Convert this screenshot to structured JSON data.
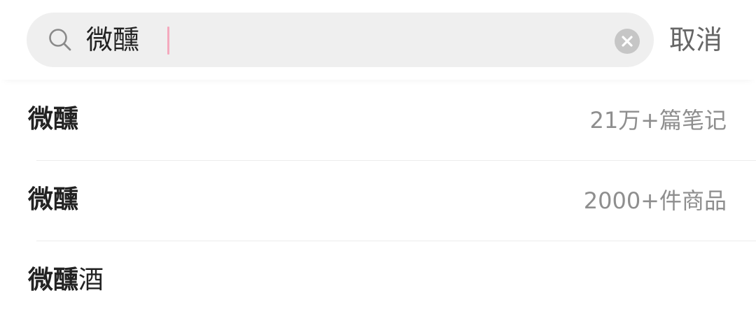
{
  "search": {
    "query": "微醺",
    "cancel_label": "取消"
  },
  "suggestions": [
    {
      "highlight": "微醺",
      "rest": "",
      "meta": "21万+篇笔记"
    },
    {
      "highlight": "微醺",
      "rest": "",
      "meta": "2000+件商品"
    },
    {
      "highlight": "微醺",
      "rest": "酒",
      "meta": ""
    }
  ],
  "colors": {
    "search_bg": "#efefef",
    "caret": "#f4a9bd",
    "meta_text": "#8e8e8e",
    "cancel_text": "#666666"
  },
  "icons": [
    "search-icon",
    "clear-icon"
  ]
}
